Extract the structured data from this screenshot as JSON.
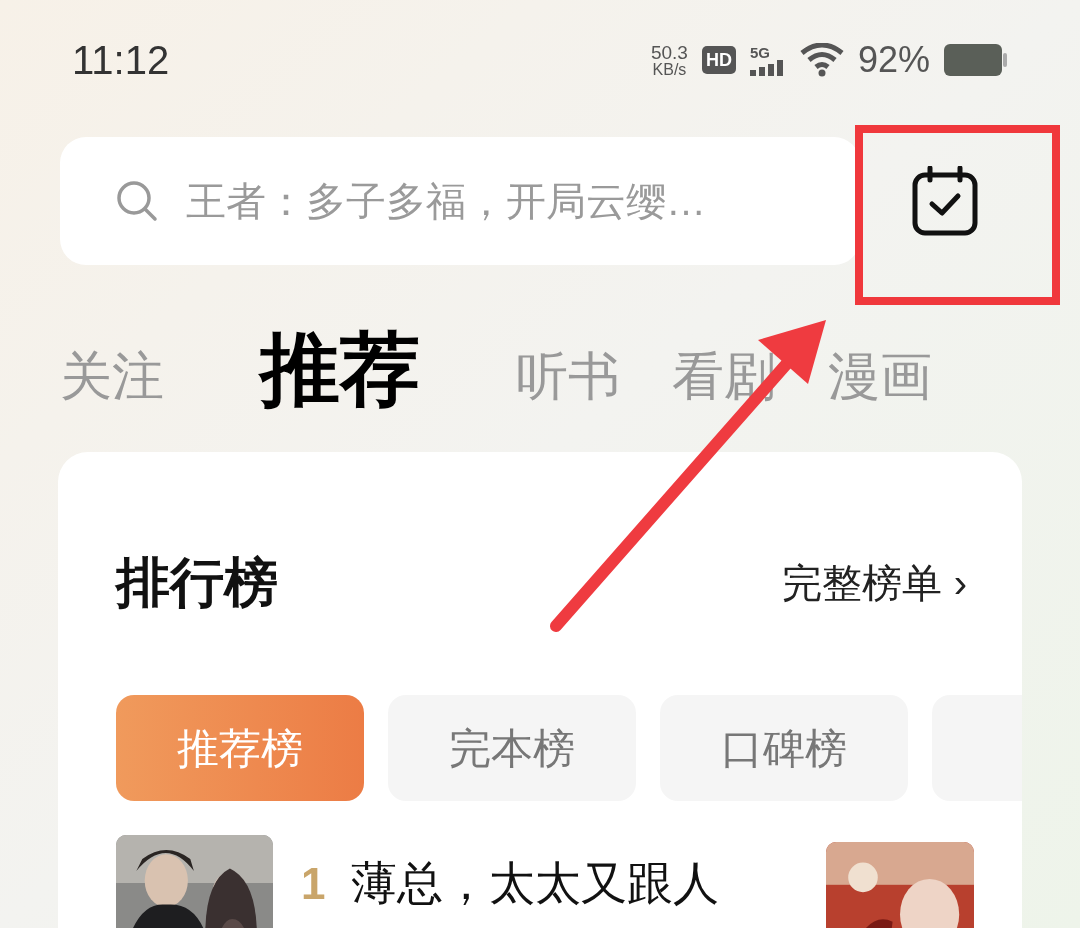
{
  "status_bar": {
    "time": "11:12",
    "speed_value": "50.3",
    "speed_unit": "KB/s",
    "hd": "HD",
    "network": "5G",
    "battery": "92%"
  },
  "search": {
    "placeholder": "王者：多子多福，开局云缨…"
  },
  "tabs": [
    {
      "label": "关注",
      "selected": false
    },
    {
      "label": "推荐",
      "selected": true
    },
    {
      "label": "听书",
      "selected": false
    },
    {
      "label": "看剧",
      "selected": false
    },
    {
      "label": "漫画",
      "selected": false
    }
  ],
  "ranking": {
    "title": "排行榜",
    "more": "完整榜单",
    "more_arrow": "›",
    "chips": [
      {
        "label": "推荐榜",
        "selected": true
      },
      {
        "label": "完本榜",
        "selected": false
      },
      {
        "label": "口碑榜",
        "selected": false
      },
      {
        "selected": false
      }
    ],
    "books": [
      {
        "rank": "1",
        "title": "薄总，太太又跟人"
      }
    ]
  }
}
